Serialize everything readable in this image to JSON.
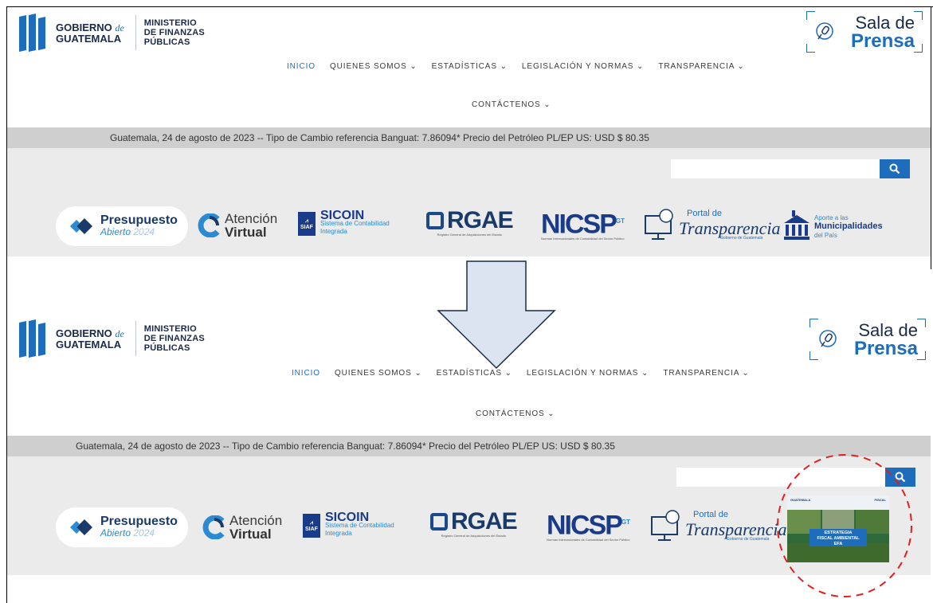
{
  "top": {
    "logo_gob": "GOBIERNO",
    "logo_de": "de",
    "logo_guat": "GUATEMALA",
    "ministerio": [
      "MINISTERIO",
      "DE FINANZAS",
      "PÚBLICAS"
    ],
    "sala1": "Sala de",
    "sala2": "Prensa",
    "nav": [
      "INICIO",
      "QUIENES SOMOS ⌄",
      "ESTADÍSTICAS ⌄",
      "LEGISLACIÓN Y NORMAS ⌄",
      "TRANSPARENCIA ⌄"
    ],
    "nav2": "CONTÁCTENOS ⌄",
    "ticker": "Guatemala, 24 de agosto de 2023 -- Tipo de Cambio referencia Banguat: 7.86094* Precio del Petróleo PL/EP US: USD $ 80.35",
    "search_placeholder": ""
  },
  "banners": {
    "presu1": "Presupuesto",
    "presu2": "Abierto",
    "presu3": "2024",
    "aten1": "Atención",
    "aten2": "Virtual",
    "sicoin_badge": "SIAF",
    "sicoin1": "SICOIN",
    "sicoin2": "Sistema de Contabilidad",
    "sicoin3": "Integrada",
    "rgae1": "RGAE",
    "rgae2": "Registro General de Adquisiciones del Estado",
    "nicsp1": "NICSP",
    "nicsp_sup": "GT",
    "nicsp2": "Normas Internacionales de Contabilidad del Sector Público",
    "portal1": "Portal de",
    "portal2": "Transparencia",
    "portal3": "Gobierno de Guatemala",
    "aporte1": "Aporte a las",
    "aporte2": "Municipalidades",
    "aporte3": "del País",
    "efa_gob": "GUATEMALA",
    "efa_fiscal": "FISCAL",
    "efa_label": [
      "ESTRATEGIA",
      "FISCAL AMBIENTAL",
      "EFA"
    ]
  },
  "colors": {
    "brand_blue": "#1e6dbd",
    "navy": "#1a3a6a",
    "ticker_bg": "#cfcfcf",
    "band_bg": "#ebebeb",
    "arrow_fill": "#dce3f1",
    "circle_red": "#e02020"
  }
}
